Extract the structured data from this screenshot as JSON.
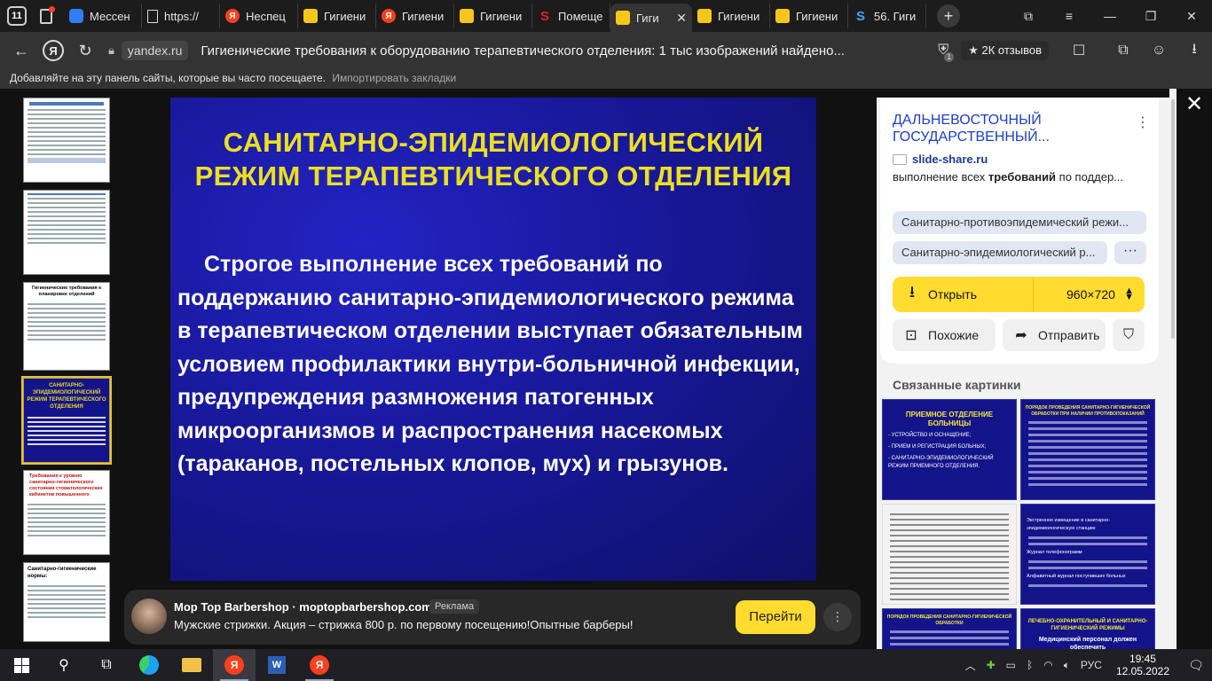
{
  "browser": {
    "tab_count": "11",
    "tabs": [
      {
        "label": "Мессен",
        "icon": "messenger-icon"
      },
      {
        "label": "https://",
        "icon": "document-icon"
      },
      {
        "label": "Неспец",
        "icon": "yandex-icon"
      },
      {
        "label": "Гигиени",
        "icon": "yandex-images-icon"
      },
      {
        "label": "Гигиени",
        "icon": "yandex-icon"
      },
      {
        "label": "Гигиени",
        "icon": "yandex-images-icon"
      },
      {
        "label": "Помеще",
        "icon": "s-icon"
      },
      {
        "label": "Гиги",
        "icon": "yandex-images-icon",
        "active": true
      },
      {
        "label": "Гигиени",
        "icon": "yandex-images-icon"
      },
      {
        "label": "Гигиени",
        "icon": "yandex-images-icon"
      },
      {
        "label": "56. Гиги",
        "icon": "dp-icon"
      }
    ],
    "domain": "yandex.ru",
    "page_title": "Гигиенические требования к оборудованию терапевтического отделения: 1 тыс изображений найдено...",
    "reviews_label": "2К отзывов",
    "extension_badge": "1",
    "bookmarks_hint": "Добавляйте на эту панель сайты, которые вы часто посещаете.",
    "bookmarks_import": "Импортировать закладки"
  },
  "slide": {
    "title_line1": "САНИТАРНО-ЭПИДЕМИОЛОГИЧЕСКИЙ",
    "title_line2": "РЕЖИМ ТЕРАПЕВТИЧЕСКОГО ОТДЕЛЕНИЯ",
    "body": "Строгое выполнение всех требований по поддержанию санитарно-эпидемиологического режима в терапевтическом отделении выступает обязательным условием профилактики внутри-больничной инфекции, предупреждения размножения патогенных микроорганизмов и распространения насекомых (тараканов, постельных клопов, мух) и грызунов.",
    "colors": {
      "title": "#ecdf1f",
      "background": "#18189a"
    }
  },
  "thumbnails": [
    {
      "title": "",
      "style": "document"
    },
    {
      "title": "",
      "style": "document"
    },
    {
      "title": "Гигиенические требования к планировке отделений",
      "style": "document"
    },
    {
      "title": "САНИТАРНО-ЭПИДЕМИОЛОГИЧЕСКИЙ РЕЖИМ ТЕРАПЕВТИЧЕСКОГО ОТДЕЛЕНИЯ",
      "style": "dark",
      "active": true
    },
    {
      "title": "Требования к уровню санитарно-гигиенического состояния стоматологических кабинетов повышенного",
      "style": "document"
    },
    {
      "title": "Санитарно-гигиенические нормы:",
      "style": "document"
    }
  ],
  "panel": {
    "source_title": "ДАЛЬНЕВОСТОЧНЫЙ ГОСУДАРСТВЕННЫЙ...",
    "source_domain": "slide-share.ru",
    "description_prefix": "выполнение всех ",
    "description_bold": "требований",
    "description_suffix": " по поддер...",
    "chips": [
      "Санитарно-противоэпидемический режи...",
      "Санитарно-эпидемиологический р..."
    ],
    "open_label": "Открыть",
    "size_label": "960×720",
    "similar_label": "Похожие",
    "share_label": "Отправить",
    "related_heading": "Связанные картинки",
    "related": [
      {
        "title": "ПРИЕМНОЕ ОТДЕЛЕНИЕ БОЛЬНИЦЫ",
        "lines": [
          "- УСТРОЙСТВО И ОСНАЩЕНИЕ;",
          "- ПРИЕМ И РЕГИСТРАЦИЯ БОЛЬНЫХ;",
          "- САНИТАРНО-ЭПИДЕМИОЛОГИЧЕСКИЙ РЕЖИМ ПРИЕМНОГО ОТДЕЛЕНИЯ."
        ],
        "style": "dark"
      },
      {
        "title": "ПОРЯДОК ПРОВЕДЕНИЯ САНИТАРНО-ГИГИЕНИЧЕСКОЙ ОБРАБОТКИ ПРИ НАЛИЧИИ ПРОТИВОПОКАЗАНИЙ",
        "lines": [],
        "style": "dark"
      },
      {
        "title": "",
        "lines": [],
        "style": "white"
      },
      {
        "title": "",
        "lines": [
          "Экстренное извещение в санитарно-эпидемиологическую станцию",
          "Журнал телефонограмм",
          "Алфавитный журнал поступивших больных"
        ],
        "style": "dark"
      },
      {
        "title": "ПОРЯДОК ПРОВЕДЕНИЯ САНИТАРНО-ГИГИЕНИЧЕСКОЙ ОБРАБОТКИ",
        "lines": [],
        "style": "dark"
      },
      {
        "title": "ЛЕЧЕБНО-ОХРАНИТЕЛЬНЫЙ И САНИТАРНО-ГИГИЕНИЧЕСКИЙ РЕЖИМЫ",
        "lines": [
          "Медицинский персонал должен обеспечить"
        ],
        "style": "dark"
      }
    ]
  },
  "ad": {
    "title": "Mop Top Barbershop · moptopbarbershop.com",
    "tag": "Реклама",
    "text": "Мужские стрижки. Акция – стрижка 800 р. по первому посещению!Опытные барберы!",
    "button": "Перейти"
  },
  "taskbar": {
    "language": "РУС",
    "time": "19:45",
    "date": "12.05.2022"
  }
}
